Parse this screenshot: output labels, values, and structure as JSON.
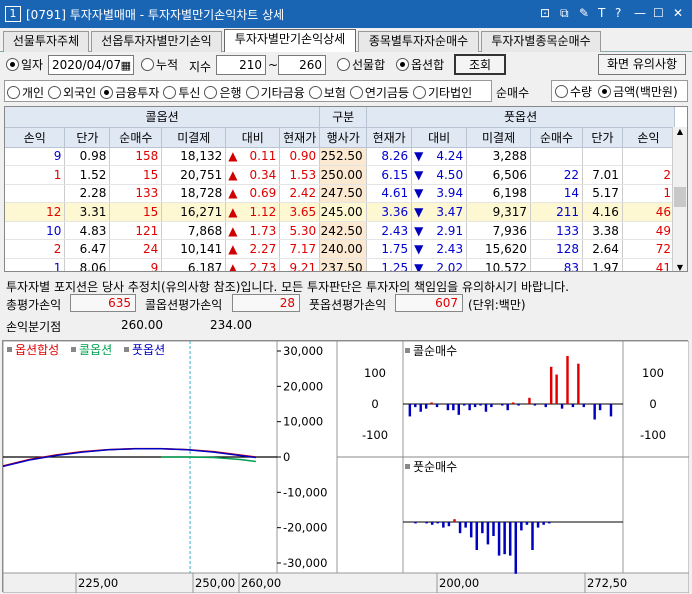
{
  "window": {
    "number": "1",
    "title": "[0791] 투자자별매매 - 투자자별만기손익차트 상세"
  },
  "tabs": [
    "선물투자주체",
    "선옵투자자별만기손익",
    "투자자별만기손익상세",
    "종목별투자자순매수",
    "투자자별종목순매수"
  ],
  "controls": {
    "date_label": "일자",
    "date_value": "2020/04/07",
    "cumulative_label": "누적",
    "index_label": "지수",
    "index_from": "210",
    "tilde": "~",
    "index_to": "260",
    "futures_sum_label": "선물합",
    "option_sum_label": "옵션합",
    "query_button": "조회",
    "notice_button": "화면 유의사항"
  },
  "investors": [
    "개인",
    "외국인",
    "금융투자",
    "투신",
    "은행",
    "기타금융",
    "보험",
    "연기금등",
    "기타법인"
  ],
  "investor_selected": "금융투자",
  "net_buy": {
    "label": "순매수",
    "options": [
      "수량",
      "금액(백만원)"
    ],
    "selected": "금액(백만원)"
  },
  "table": {
    "call_header": "콜옵션",
    "mid_header": "구분",
    "put_header": "풋옵션",
    "columns": [
      "손익",
      "단가",
      "순매수",
      "미결제",
      "대비",
      "현재가",
      "행사가",
      "현재가",
      "대비",
      "미결제",
      "순매수",
      "단가",
      "손익"
    ],
    "rows": [
      {
        "c_pl": "9",
        "c_price": "0.98",
        "c_net": "158",
        "c_oi": "18,132",
        "c_arrow": "▲",
        "c_chg": "0.11",
        "c_cur": "0.90",
        "strike": "252.50",
        "p_cur": "8.26",
        "p_arrow": "▼",
        "p_chg": "4.24",
        "p_oi": "3,288",
        "p_net": "",
        "p_price": "",
        "p_pl": ""
      },
      {
        "c_pl": "1",
        "c_price": "1.52",
        "c_net": "15",
        "c_oi": "20,751",
        "c_arrow": "▲",
        "c_chg": "0.34",
        "c_cur": "1.53",
        "strike": "250.00",
        "p_cur": "6.15",
        "p_arrow": "▼",
        "p_chg": "4.50",
        "p_oi": "6,506",
        "p_net": "22",
        "p_price": "7.01",
        "p_pl": "2"
      },
      {
        "c_pl": "",
        "c_price": "2.28",
        "c_net": "133",
        "c_oi": "18,728",
        "c_arrow": "▲",
        "c_chg": "0.69",
        "c_cur": "2.42",
        "strike": "247.50",
        "p_cur": "4.61",
        "p_arrow": "▼",
        "p_chg": "3.94",
        "p_oi": "6,198",
        "p_net": "14",
        "p_price": "5.17",
        "p_pl": "1"
      },
      {
        "c_pl": "12",
        "c_price": "3.31",
        "c_net": "15",
        "c_oi": "16,271",
        "c_arrow": "▲",
        "c_chg": "1.12",
        "c_cur": "3.65",
        "strike": "245.00",
        "p_cur": "3.36",
        "p_arrow": "▼",
        "p_chg": "3.47",
        "p_oi": "9,317",
        "p_net": "211",
        "p_price": "4.16",
        "p_pl": "46"
      },
      {
        "c_pl": "10",
        "c_price": "4.83",
        "c_net": "121",
        "c_oi": "7,868",
        "c_arrow": "▲",
        "c_chg": "1.73",
        "c_cur": "5.30",
        "strike": "242.50",
        "p_cur": "2.43",
        "p_arrow": "▼",
        "p_chg": "2.91",
        "p_oi": "7,936",
        "p_net": "133",
        "p_price": "3.38",
        "p_pl": "49"
      },
      {
        "c_pl": "2",
        "c_price": "6.47",
        "c_net": "24",
        "c_oi": "10,141",
        "c_arrow": "▲",
        "c_chg": "2.27",
        "c_cur": "7.17",
        "strike": "240.00",
        "p_cur": "1.75",
        "p_arrow": "▼",
        "p_chg": "2.43",
        "p_oi": "15,620",
        "p_net": "128",
        "p_price": "2.64",
        "p_pl": "72"
      },
      {
        "c_pl": "1",
        "c_price": "8.06",
        "c_net": "9",
        "c_oi": "6,187",
        "c_arrow": "▲",
        "c_chg": "2.73",
        "c_cur": "9.21",
        "strike": "237.50",
        "p_cur": "1.25",
        "p_arrow": "▼",
        "p_chg": "2.02",
        "p_oi": "10,572",
        "p_net": "83",
        "p_price": "1.97",
        "p_pl": "41"
      }
    ]
  },
  "summary": {
    "notice": "투자자별 포지션은 당사 추정치(유의사항 참조)입니다. 모든 투자판단은 투자자의 책임임을 유의하시기 바랍니다.",
    "total_label": "총평가손익",
    "total_value": "635",
    "call_label": "콜옵션평가손익",
    "call_value": "28",
    "put_label": "풋옵션평가손익",
    "put_value": "607",
    "unit": "(단위:백만)",
    "breakeven_label": "손익분기점",
    "breakeven_1": "260.00",
    "breakeven_2": "234.00"
  },
  "chart_data": [
    {
      "type": "line",
      "title": "",
      "legend": [
        "옵션합성",
        "콜옵션",
        "풋옵션"
      ],
      "yticks": [
        "30,000",
        "20,000",
        "10,000",
        "0",
        "-10,000",
        "-20,000",
        "-30,000"
      ],
      "ylim": [
        -30000,
        30000
      ],
      "xticks": [
        "225,00",
        "250,00",
        "260,00"
      ],
      "series": [
        {
          "name": "옵션합성",
          "color": "#e00000",
          "x": [
            210,
            215,
            220,
            225,
            230,
            235,
            240,
            245,
            250,
            255,
            258
          ],
          "values": [
            -1800,
            -500,
            400,
            1100,
            1500,
            1700,
            1700,
            1500,
            1100,
            400,
            0
          ]
        },
        {
          "name": "콜옵션",
          "color": "#00a050",
          "x": [
            240,
            245,
            250,
            255,
            258
          ],
          "values": [
            0,
            0,
            -100,
            -500,
            -900
          ]
        },
        {
          "name": "풋옵션",
          "color": "#0000c0",
          "x": [
            210,
            215,
            220,
            225,
            230,
            235,
            240,
            245,
            250,
            255,
            258
          ],
          "values": [
            -1900,
            -600,
            300,
            1000,
            1450,
            1650,
            1650,
            1450,
            1000,
            300,
            -100
          ]
        }
      ]
    },
    {
      "type": "bar",
      "title": "콜순매수",
      "yticks": [
        "100",
        "0",
        "-100"
      ],
      "ylim": [
        -150,
        150
      ],
      "x": [
        175,
        177.5,
        180,
        182.5,
        185,
        187.5,
        190,
        192.5,
        195,
        197.5,
        200,
        202.5,
        205,
        207.5,
        210,
        212.5,
        215,
        217.5,
        220,
        222.5,
        225,
        227.5,
        230,
        232.5,
        235,
        237.5,
        240,
        242.5,
        245,
        247.5,
        250,
        252.5,
        255,
        257.5,
        260,
        262.5,
        265,
        267.5,
        270
      ],
      "values": [
        -40,
        -10,
        -25,
        -15,
        5,
        -10,
        0,
        -20,
        -20,
        -35,
        -5,
        -20,
        -10,
        -5,
        -25,
        -10,
        0,
        -5,
        -20,
        5,
        -5,
        0,
        20,
        -5,
        0,
        -10,
        120,
        95,
        -15,
        155,
        -10,
        130,
        -10,
        0,
        -50,
        -20,
        0,
        -40,
        0
      ]
    },
    {
      "type": "bar",
      "title": "풋순매수",
      "yticks": [],
      "ylim": [
        -200,
        40
      ],
      "values": [
        0,
        -5,
        0,
        -5,
        -10,
        -5,
        -20,
        -15,
        10,
        -40,
        -20,
        -55,
        -100,
        -40,
        -80,
        -50,
        -120,
        -115,
        -120,
        -185,
        -30,
        -10,
        -100,
        -20,
        -10,
        -5,
        0,
        0
      ]
    }
  ],
  "xaxis2": [
    "200,00",
    "272,50"
  ]
}
